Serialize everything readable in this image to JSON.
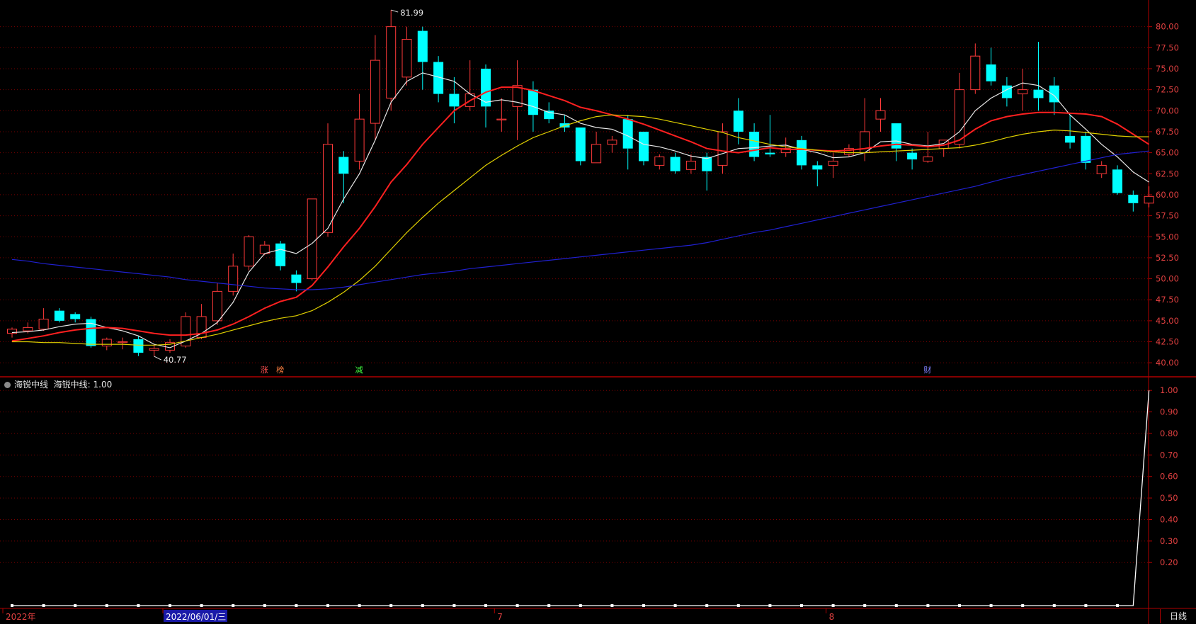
{
  "indicator_title": "海锐中线",
  "indicator_value_text": "海锐中线: 1.00",
  "period_label": "日线",
  "axis_text_color": "#e04040",
  "colors": {
    "up_candle": "#ff3a3a",
    "down_candle": "#00ffff",
    "ma_fast": "#e8e8e8",
    "ma_mid": "#ff2020",
    "ma_slow": "#e0d000",
    "ma_long": "#2020d0",
    "grid": "#7a0000",
    "frame": "#b00000",
    "indicator_line": "#ffffff"
  },
  "chart_data": [
    {
      "type": "candlestick",
      "title": "",
      "ylim": [
        38.5,
        82.5
      ],
      "y_ticks": [
        "80.00",
        "77.50",
        "75.00",
        "72.50",
        "70.00",
        "67.50",
        "65.00",
        "62.50",
        "60.00",
        "57.50",
        "55.00",
        "52.50",
        "50.00",
        "47.50",
        "45.00",
        "42.50",
        "40.00"
      ],
      "annotations": {
        "high_label": "81.99",
        "low_label": "40.77"
      },
      "event_markers": [
        {
          "text": "涨",
          "index": 16,
          "color": "#ff5050"
        },
        {
          "text": "榜",
          "index": 17,
          "color": "#ff8040"
        },
        {
          "text": "减",
          "index": 22,
          "color": "#40ff40"
        },
        {
          "text": "财",
          "index": 58,
          "color": "#8080ff"
        }
      ],
      "x_labels": [
        {
          "text": "2022年",
          "index": 0
        },
        {
          "text": "2022/06/01/三",
          "index": 10,
          "highlight": true
        },
        {
          "text": "7",
          "index": 31
        },
        {
          "text": "8",
          "index": 52
        }
      ],
      "candles": [
        [
          43.5,
          44.0,
          43.0,
          44.2
        ],
        [
          43.8,
          44.2,
          43.5,
          44.8
        ],
        [
          44.0,
          45.2,
          43.8,
          46.5
        ],
        [
          46.2,
          45.0,
          44.8,
          46.5
        ],
        [
          45.8,
          45.2,
          44.8,
          46.0
        ],
        [
          45.2,
          42.0,
          41.8,
          45.5
        ],
        [
          42.0,
          42.8,
          41.5,
          43.0
        ],
        [
          42.5,
          42.5,
          41.6,
          43.0
        ],
        [
          42.8,
          41.2,
          40.8,
          43.2
        ],
        [
          41.5,
          41.7,
          40.77,
          42.2
        ],
        [
          41.5,
          42.4,
          41.2,
          42.8
        ],
        [
          42.0,
          45.5,
          41.8,
          46.0
        ],
        [
          43.0,
          45.5,
          42.8,
          47.0
        ],
        [
          45.0,
          48.5,
          44.5,
          49.5
        ],
        [
          48.5,
          51.5,
          48.0,
          53.0
        ],
        [
          51.5,
          55.0,
          51.0,
          55.2
        ],
        [
          53.0,
          54.0,
          52.8,
          54.5
        ],
        [
          54.2,
          51.5,
          51.0,
          54.5
        ],
        [
          50.5,
          49.5,
          48.5,
          51.0
        ],
        [
          50.0,
          59.5,
          49.8,
          59.5
        ],
        [
          55.5,
          66.0,
          55.0,
          68.5
        ],
        [
          64.5,
          62.5,
          59.0,
          65.2
        ],
        [
          64.0,
          69.0,
          63.0,
          72.0
        ],
        [
          68.5,
          76.0,
          66.5,
          79.0
        ],
        [
          71.5,
          80.0,
          70.0,
          81.99
        ],
        [
          74.0,
          78.5,
          73.0,
          80.0
        ],
        [
          79.5,
          75.8,
          72.5,
          80.0
        ],
        [
          75.8,
          72.0,
          71.0,
          76.5
        ],
        [
          72.0,
          70.5,
          68.5,
          74.0
        ],
        [
          70.5,
          72.0,
          70.0,
          76.0
        ],
        [
          75.0,
          70.5,
          68.0,
          75.5
        ],
        [
          69.0,
          69.0,
          67.5,
          71.5
        ],
        [
          70.5,
          73.0,
          66.5,
          76.0
        ],
        [
          72.5,
          69.5,
          67.5,
          73.5
        ],
        [
          70.0,
          69.0,
          68.5,
          71.0
        ],
        [
          68.5,
          68.0,
          67.5,
          69.5
        ],
        [
          68.0,
          64.0,
          63.5,
          68.0
        ],
        [
          63.8,
          66.0,
          63.8,
          67.5
        ],
        [
          66.0,
          66.5,
          65.0,
          67.0
        ],
        [
          69.0,
          65.5,
          63.0,
          69.5
        ],
        [
          67.5,
          64.0,
          63.5,
          67.5
        ],
        [
          63.5,
          64.5,
          63.0,
          64.8
        ],
        [
          64.5,
          62.8,
          62.5,
          65.0
        ],
        [
          63.0,
          64.0,
          62.5,
          64.8
        ],
        [
          64.5,
          62.8,
          60.5,
          65.0
        ],
        [
          63.5,
          67.5,
          62.5,
          68.5
        ],
        [
          70.0,
          67.5,
          66.0,
          71.5
        ],
        [
          67.5,
          64.5,
          64.0,
          68.5
        ],
        [
          65.0,
          64.8,
          64.5,
          69.5
        ],
        [
          65.0,
          65.5,
          64.5,
          66.8
        ],
        [
          66.5,
          63.5,
          63.0,
          67.0
        ],
        [
          63.5,
          63.0,
          61.0,
          64.0
        ],
        [
          63.5,
          64.0,
          62.0,
          65.0
        ],
        [
          64.8,
          65.5,
          64.5,
          66.0
        ],
        [
          65.0,
          67.5,
          64.0,
          71.5
        ],
        [
          69.0,
          70.0,
          67.5,
          71.5
        ],
        [
          68.5,
          65.5,
          64.0,
          68.5
        ],
        [
          65.0,
          64.2,
          63.0,
          65.5
        ],
        [
          64.0,
          64.5,
          63.8,
          67.5
        ],
        [
          65.5,
          66.5,
          64.5,
          66.5
        ],
        [
          66.0,
          72.5,
          65.5,
          74.5
        ],
        [
          72.5,
          76.5,
          72.0,
          78.0
        ],
        [
          75.5,
          73.5,
          73.0,
          77.5
        ],
        [
          73.0,
          71.5,
          70.5,
          74.0
        ],
        [
          72.0,
          72.5,
          70.0,
          75.0
        ],
        [
          72.5,
          71.5,
          70.0,
          78.2
        ],
        [
          73.0,
          71.0,
          69.5,
          74.0
        ],
        [
          67.0,
          66.2,
          65.5,
          69.5
        ],
        [
          67.0,
          63.8,
          63.0,
          67.5
        ],
        [
          62.5,
          63.5,
          62.0,
          64.0
        ],
        [
          63.0,
          60.2,
          60.0,
          63.5
        ],
        [
          60.0,
          59.0,
          58.0,
          60.5
        ],
        [
          59.0,
          59.8,
          58.5,
          61.0
        ]
      ],
      "series": [
        {
          "name": "",
          "color_key": "ma_fast",
          "values": [
            43.6,
            43.7,
            43.9,
            44.3,
            44.6,
            44.7,
            44.2,
            43.8,
            43.2,
            42.2,
            41.8,
            42.6,
            43.5,
            44.8,
            47.2,
            50.8,
            53.0,
            53.5,
            53.0,
            54.2,
            56.0,
            59.5,
            62.5,
            66.5,
            71.0,
            73.5,
            74.5,
            74.0,
            73.5,
            72.0,
            71.0,
            71.3,
            71.0,
            70.5,
            69.8,
            69.5,
            68.5,
            68.0,
            67.8,
            67.0,
            66.0,
            65.7,
            65.2,
            64.6,
            64.3,
            64.9,
            65.5,
            65.6,
            65.8,
            65.9,
            65.4,
            65.0,
            64.4,
            64.5,
            65.0,
            66.3,
            66.4,
            66.0,
            65.8,
            66.1,
            67.5,
            70.0,
            71.5,
            72.5,
            73.3,
            73.0,
            71.8,
            69.5,
            67.8,
            66.0,
            64.5,
            62.7,
            61.5
          ]
        },
        {
          "name": "",
          "color_key": "ma_mid",
          "values": [
            42.6,
            42.9,
            43.2,
            43.6,
            43.9,
            44.1,
            44.2,
            44.1,
            43.8,
            43.5,
            43.3,
            43.3,
            43.5,
            43.9,
            44.6,
            45.5,
            46.5,
            47.3,
            47.8,
            49.2,
            51.4,
            53.8,
            56.0,
            58.6,
            61.5,
            63.6,
            66.0,
            68.0,
            70.0,
            71.2,
            72.2,
            72.8,
            72.8,
            72.4,
            71.8,
            71.2,
            70.4,
            70.0,
            69.5,
            69.0,
            68.4,
            67.7,
            67.0,
            66.3,
            65.5,
            65.2,
            65.0,
            65.3,
            65.6,
            65.4,
            65.4,
            65.3,
            65.2,
            65.3,
            65.5,
            65.8,
            66.0,
            65.9,
            65.7,
            65.9,
            66.5,
            67.8,
            68.8,
            69.3,
            69.6,
            69.8,
            69.8,
            69.7,
            69.6,
            69.3,
            68.4,
            67.2,
            66.0
          ]
        },
        {
          "name": "",
          "color_key": "ma_slow",
          "values": [
            42.5,
            42.5,
            42.4,
            42.4,
            42.3,
            42.2,
            42.2,
            42.2,
            42.1,
            42.1,
            42.2,
            42.6,
            43.0,
            43.4,
            43.9,
            44.4,
            44.9,
            45.3,
            45.6,
            46.2,
            47.2,
            48.4,
            49.8,
            51.5,
            53.5,
            55.5,
            57.3,
            59.0,
            60.5,
            62.0,
            63.5,
            64.7,
            65.8,
            66.8,
            67.5,
            68.2,
            68.8,
            69.3,
            69.5,
            69.4,
            69.3,
            69.0,
            68.6,
            68.2,
            67.8,
            67.4,
            66.8,
            66.4,
            66.0,
            65.7,
            65.5,
            65.3,
            65.1,
            65.0,
            65.0,
            65.1,
            65.2,
            65.3,
            65.4,
            65.5,
            65.6,
            65.9,
            66.3,
            66.8,
            67.2,
            67.5,
            67.7,
            67.6,
            67.4,
            67.2,
            67.0,
            66.9,
            66.9
          ]
        },
        {
          "name": "",
          "color_key": "ma_long",
          "values": [
            52.3,
            52.1,
            51.8,
            51.6,
            51.4,
            51.2,
            51.0,
            50.8,
            50.6,
            50.4,
            50.2,
            49.9,
            49.7,
            49.5,
            49.3,
            49.1,
            48.9,
            48.8,
            48.7,
            48.7,
            48.8,
            49.0,
            49.3,
            49.6,
            49.9,
            50.2,
            50.5,
            50.7,
            50.9,
            51.2,
            51.4,
            51.6,
            51.8,
            52.0,
            52.2,
            52.4,
            52.6,
            52.8,
            53.0,
            53.2,
            53.4,
            53.6,
            53.8,
            54.0,
            54.3,
            54.7,
            55.1,
            55.5,
            55.8,
            56.2,
            56.6,
            57.0,
            57.4,
            57.8,
            58.2,
            58.6,
            59.0,
            59.4,
            59.8,
            60.2,
            60.6,
            61.0,
            61.5,
            62.0,
            62.4,
            62.8,
            63.2,
            63.6,
            64.0,
            64.4,
            64.8,
            65.0,
            65.2
          ]
        }
      ]
    },
    {
      "type": "line",
      "title": "海锐中线",
      "ylim": [
        0,
        1.05
      ],
      "y_ticks": [
        "1.00",
        "0.90",
        "0.80",
        "0.70",
        "0.60",
        "0.50",
        "0.40",
        "0.30",
        "0.20"
      ],
      "series": [
        {
          "name": "海锐中线",
          "values": [
            0,
            0,
            0,
            0,
            0,
            0,
            0,
            0,
            0,
            0,
            0,
            0,
            0,
            0,
            0,
            0,
            0,
            0,
            0,
            0,
            0,
            0,
            0,
            0,
            0,
            0,
            0,
            0,
            0,
            0,
            0,
            0,
            0,
            0,
            0,
            0,
            0,
            0,
            0,
            0,
            0,
            0,
            0,
            0,
            0,
            0,
            0,
            0,
            0,
            0,
            0,
            0,
            0,
            0,
            0,
            0,
            0,
            0,
            0,
            0,
            0,
            0,
            0,
            0,
            0,
            0,
            0,
            0,
            0,
            0,
            0,
            0,
            1.0
          ]
        }
      ]
    }
  ]
}
